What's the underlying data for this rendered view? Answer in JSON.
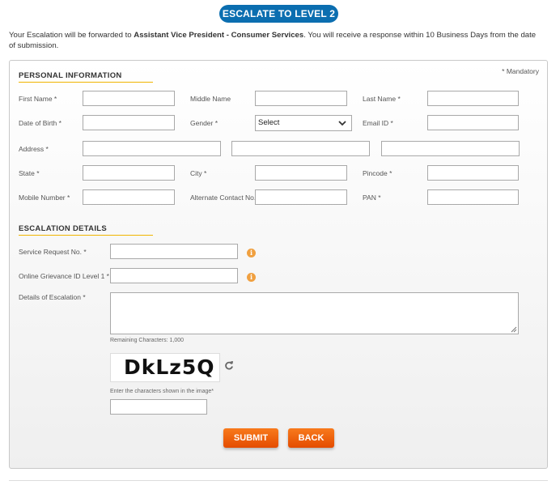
{
  "header": {
    "title": "ESCALATE TO LEVEL 2"
  },
  "intro": {
    "text_before": "Your Escalation will be forwarded to ",
    "recipient": "Assistant Vice President - Consumer Services",
    "text_after": ". You will receive a response within 10 Business Days from the date of submission."
  },
  "form": {
    "mandatory_note": "* Mandatory",
    "personal": {
      "heading": "PERSONAL INFORMATION",
      "first_name_label": "First Name *",
      "middle_name_label": "Middle Name",
      "last_name_label": "Last Name *",
      "dob_label": "Date of Birth *",
      "gender_label": "Gender *",
      "gender_value": "Select",
      "email_label": "Email ID *",
      "address_label": "Address *",
      "state_label": "State *",
      "city_label": "City *",
      "pincode_label": "Pincode *",
      "mobile_label": "Mobile Number *",
      "alt_contact_label": "Alternate Contact No.",
      "pan_label": "PAN *"
    },
    "escalation": {
      "heading": "ESCALATION DETAILS",
      "service_request_label": "Service Request No. *",
      "grievance_label": "Online Grievance ID Level 1 *",
      "details_label": "Details of Escalation *",
      "remaining": "Remaining Characters: 1,000",
      "captcha_text": "DkLz5Q",
      "captcha_hint": "Enter the characters shown in the image*"
    },
    "buttons": {
      "submit": "SUBMIT",
      "back": "BACK"
    }
  },
  "colors": {
    "accent": "#0b6eb0",
    "button": "#f26a10",
    "section_rule": "#f0b400"
  },
  "icons": {
    "info": "info-icon",
    "refresh": "refresh-icon",
    "dropdown": "chevron-down-icon"
  }
}
